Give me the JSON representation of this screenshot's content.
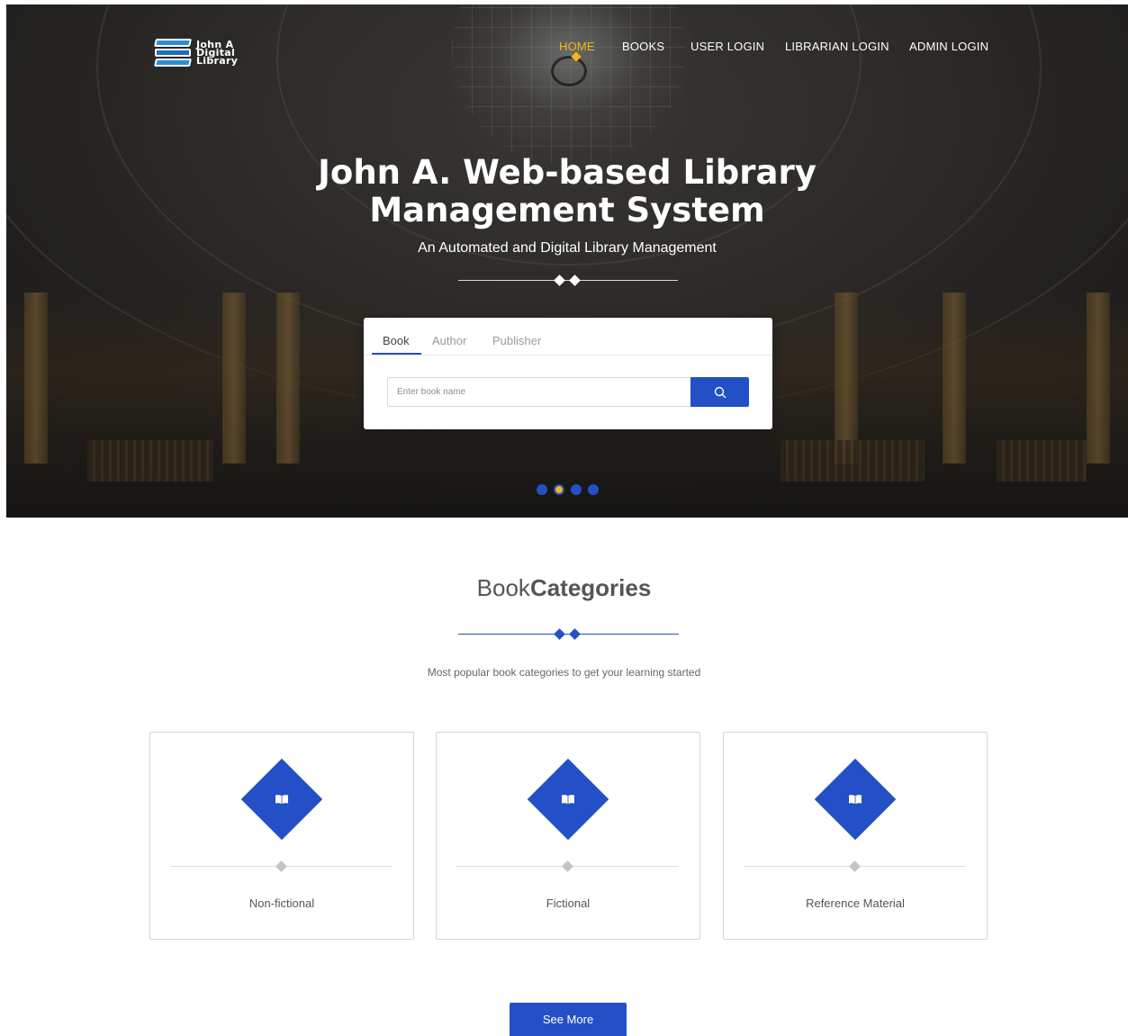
{
  "brand": {
    "logo_line1": "John A",
    "logo_line2": "Digital",
    "logo_line3": "Library"
  },
  "nav": {
    "items": [
      {
        "label": "HOME",
        "active": true
      },
      {
        "label": "BOOKS",
        "active": false
      },
      {
        "label": "USER LOGIN",
        "active": false
      },
      {
        "label": "LIBRARIAN LOGIN",
        "active": false
      },
      {
        "label": "ADMIN LOGIN",
        "active": false
      }
    ]
  },
  "hero": {
    "title_line1": "John A. Web-based Library",
    "title_line2": "Management System",
    "subtitle": "An Automated and Digital Library Management"
  },
  "search": {
    "tabs": [
      "Book",
      "Author",
      "Publisher"
    ],
    "active_tab": "Book",
    "input_value": "",
    "placeholder": "Enter book name",
    "button_icon": "search-icon"
  },
  "carousel": {
    "slide_count": 4,
    "active_index": 1
  },
  "categories": {
    "title_light": "Book",
    "title_bold": "Categories",
    "subtitle": "Most popular book categories to get your learning started",
    "items": [
      {
        "label": "Non-fictional",
        "icon": "open-book-icon"
      },
      {
        "label": "Fictional",
        "icon": "open-book-icon"
      },
      {
        "label": "Reference Material",
        "icon": "open-book-icon"
      }
    ],
    "see_more_label": "See More"
  },
  "colors": {
    "accent_blue": "#2350c7",
    "accent_yellow": "#f3b619",
    "text_dark": "#555555"
  }
}
